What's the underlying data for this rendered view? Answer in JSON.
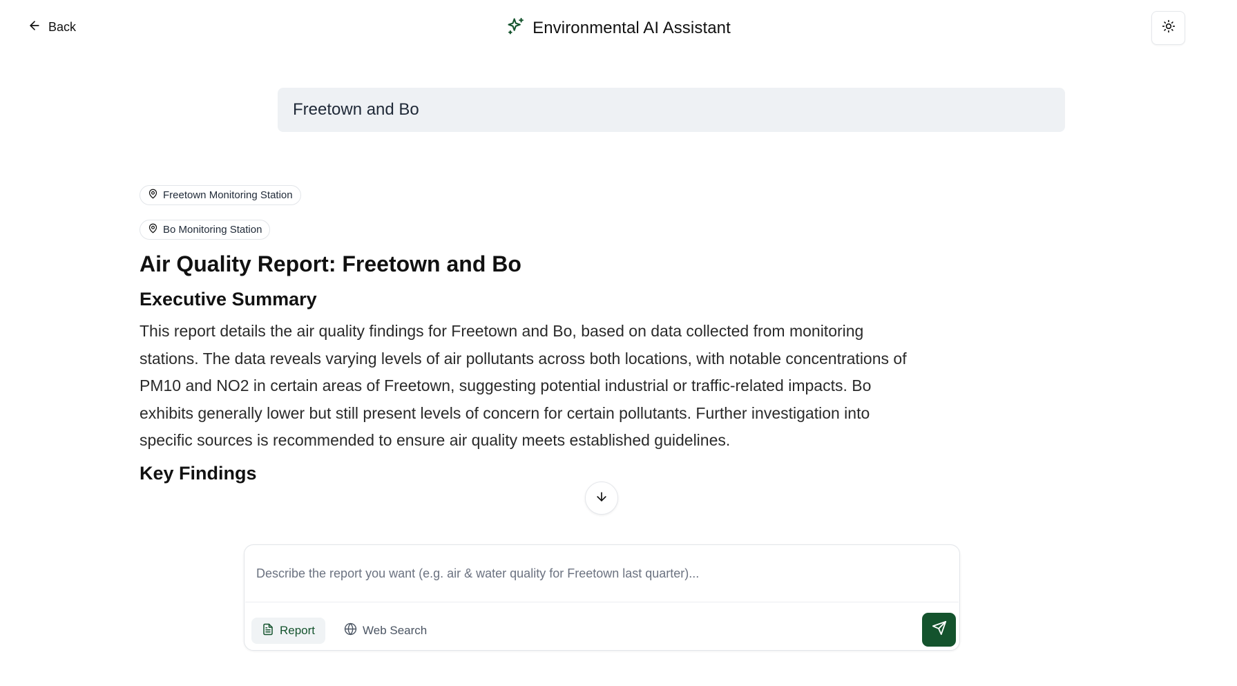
{
  "header": {
    "back_label": "Back",
    "app_title": "Environmental AI Assistant",
    "accent_color": "#14532d",
    "icons": {
      "back": "arrow-left-icon",
      "title": "sparkles-icon",
      "theme": "sun-icon"
    }
  },
  "conversation": {
    "user_query": "Freetown and Bo",
    "stations": [
      {
        "label": "Freetown Monitoring Station",
        "icon": "map-pin-icon"
      },
      {
        "label": "Bo Monitoring Station",
        "icon": "map-pin-icon"
      }
    ],
    "report_title": "Air Quality Report: Freetown and Bo",
    "executive_heading": "Executive Summary",
    "executive_summary": "This report details the air quality findings for Freetown and Bo, based on data collected from monitoring stations. The data reveals varying levels of air pollutants across both locations, with notable concentrations of PM10 and NO2 in certain areas of Freetown, suggesting potential industrial or traffic-related impacts. Bo exhibits generally lower but still present levels of concern for certain pollutants. Further investigation into specific sources is recommended to ensure air quality meets established guidelines.",
    "key_findings_heading": "Key Findings"
  },
  "composer": {
    "placeholder": "Describe the report you want (e.g. air & water quality for Freetown last quarter)...",
    "value": "",
    "modes": {
      "report_label": "Report",
      "web_search_label": "Web Search",
      "selected": "Report"
    },
    "icons": {
      "report": "file-text-icon",
      "web_search": "globe-icon",
      "send": "send-icon",
      "scroll": "arrow-down-icon"
    }
  }
}
